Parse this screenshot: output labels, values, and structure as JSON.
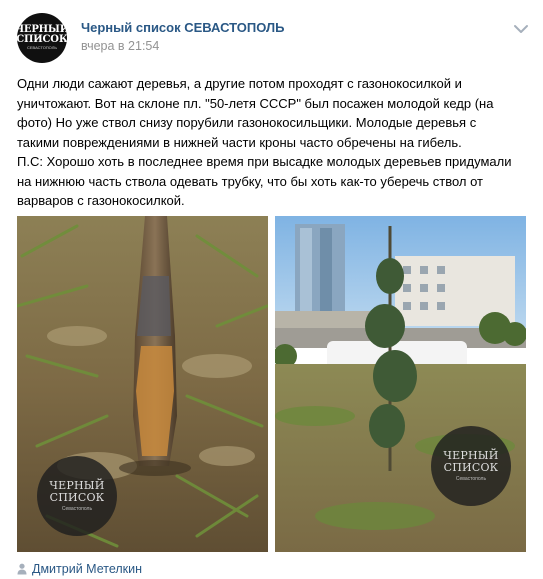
{
  "post": {
    "group": {
      "name": "Черный список СЕВАСТОПОЛЬ",
      "time": "вчера в 21:54",
      "avatar_line1": "ЧЕРНЫЙ",
      "avatar_line2": "СПИСОК",
      "avatar_line3": "СЕВАСТОПОЛЬ"
    },
    "text": "Одни люди сажают деревья, а другие потом проходят с газонокосилкой и\nуничтожают. Вот на склоне пл. \"50-летя СССР\" был посажен молодой кедр (на\nфото) Но уже ствол снизу порубили газонокосильщики. Молодые деревья с\nтакими повреждениями в нижней части кроны часто обречены на гибель.\nП.С: Хорошо хоть в последнее время при высадке молодых деревьев придумали\nна нижнюю часть ствола одевать трубку, что бы хоть как-то уберечь ствол от\nварваров с газонокосилкой.",
    "photos": [
      {
        "watermark_line1": "ЧЕРНЫЙ",
        "watermark_line2": "СПИСОК",
        "watermark_line3": "Севастополь"
      },
      {
        "watermark_line1": "ЧЕРНЫЙ",
        "watermark_line2": "СПИСОК",
        "watermark_line3": "Севастополь"
      }
    ],
    "signer": {
      "name": "Дмитрий Метелкин",
      "icon": "user-icon"
    },
    "menu_icon": "chevron-down-icon",
    "colors": {
      "link": "#2a5885",
      "meta": "#939393"
    }
  }
}
